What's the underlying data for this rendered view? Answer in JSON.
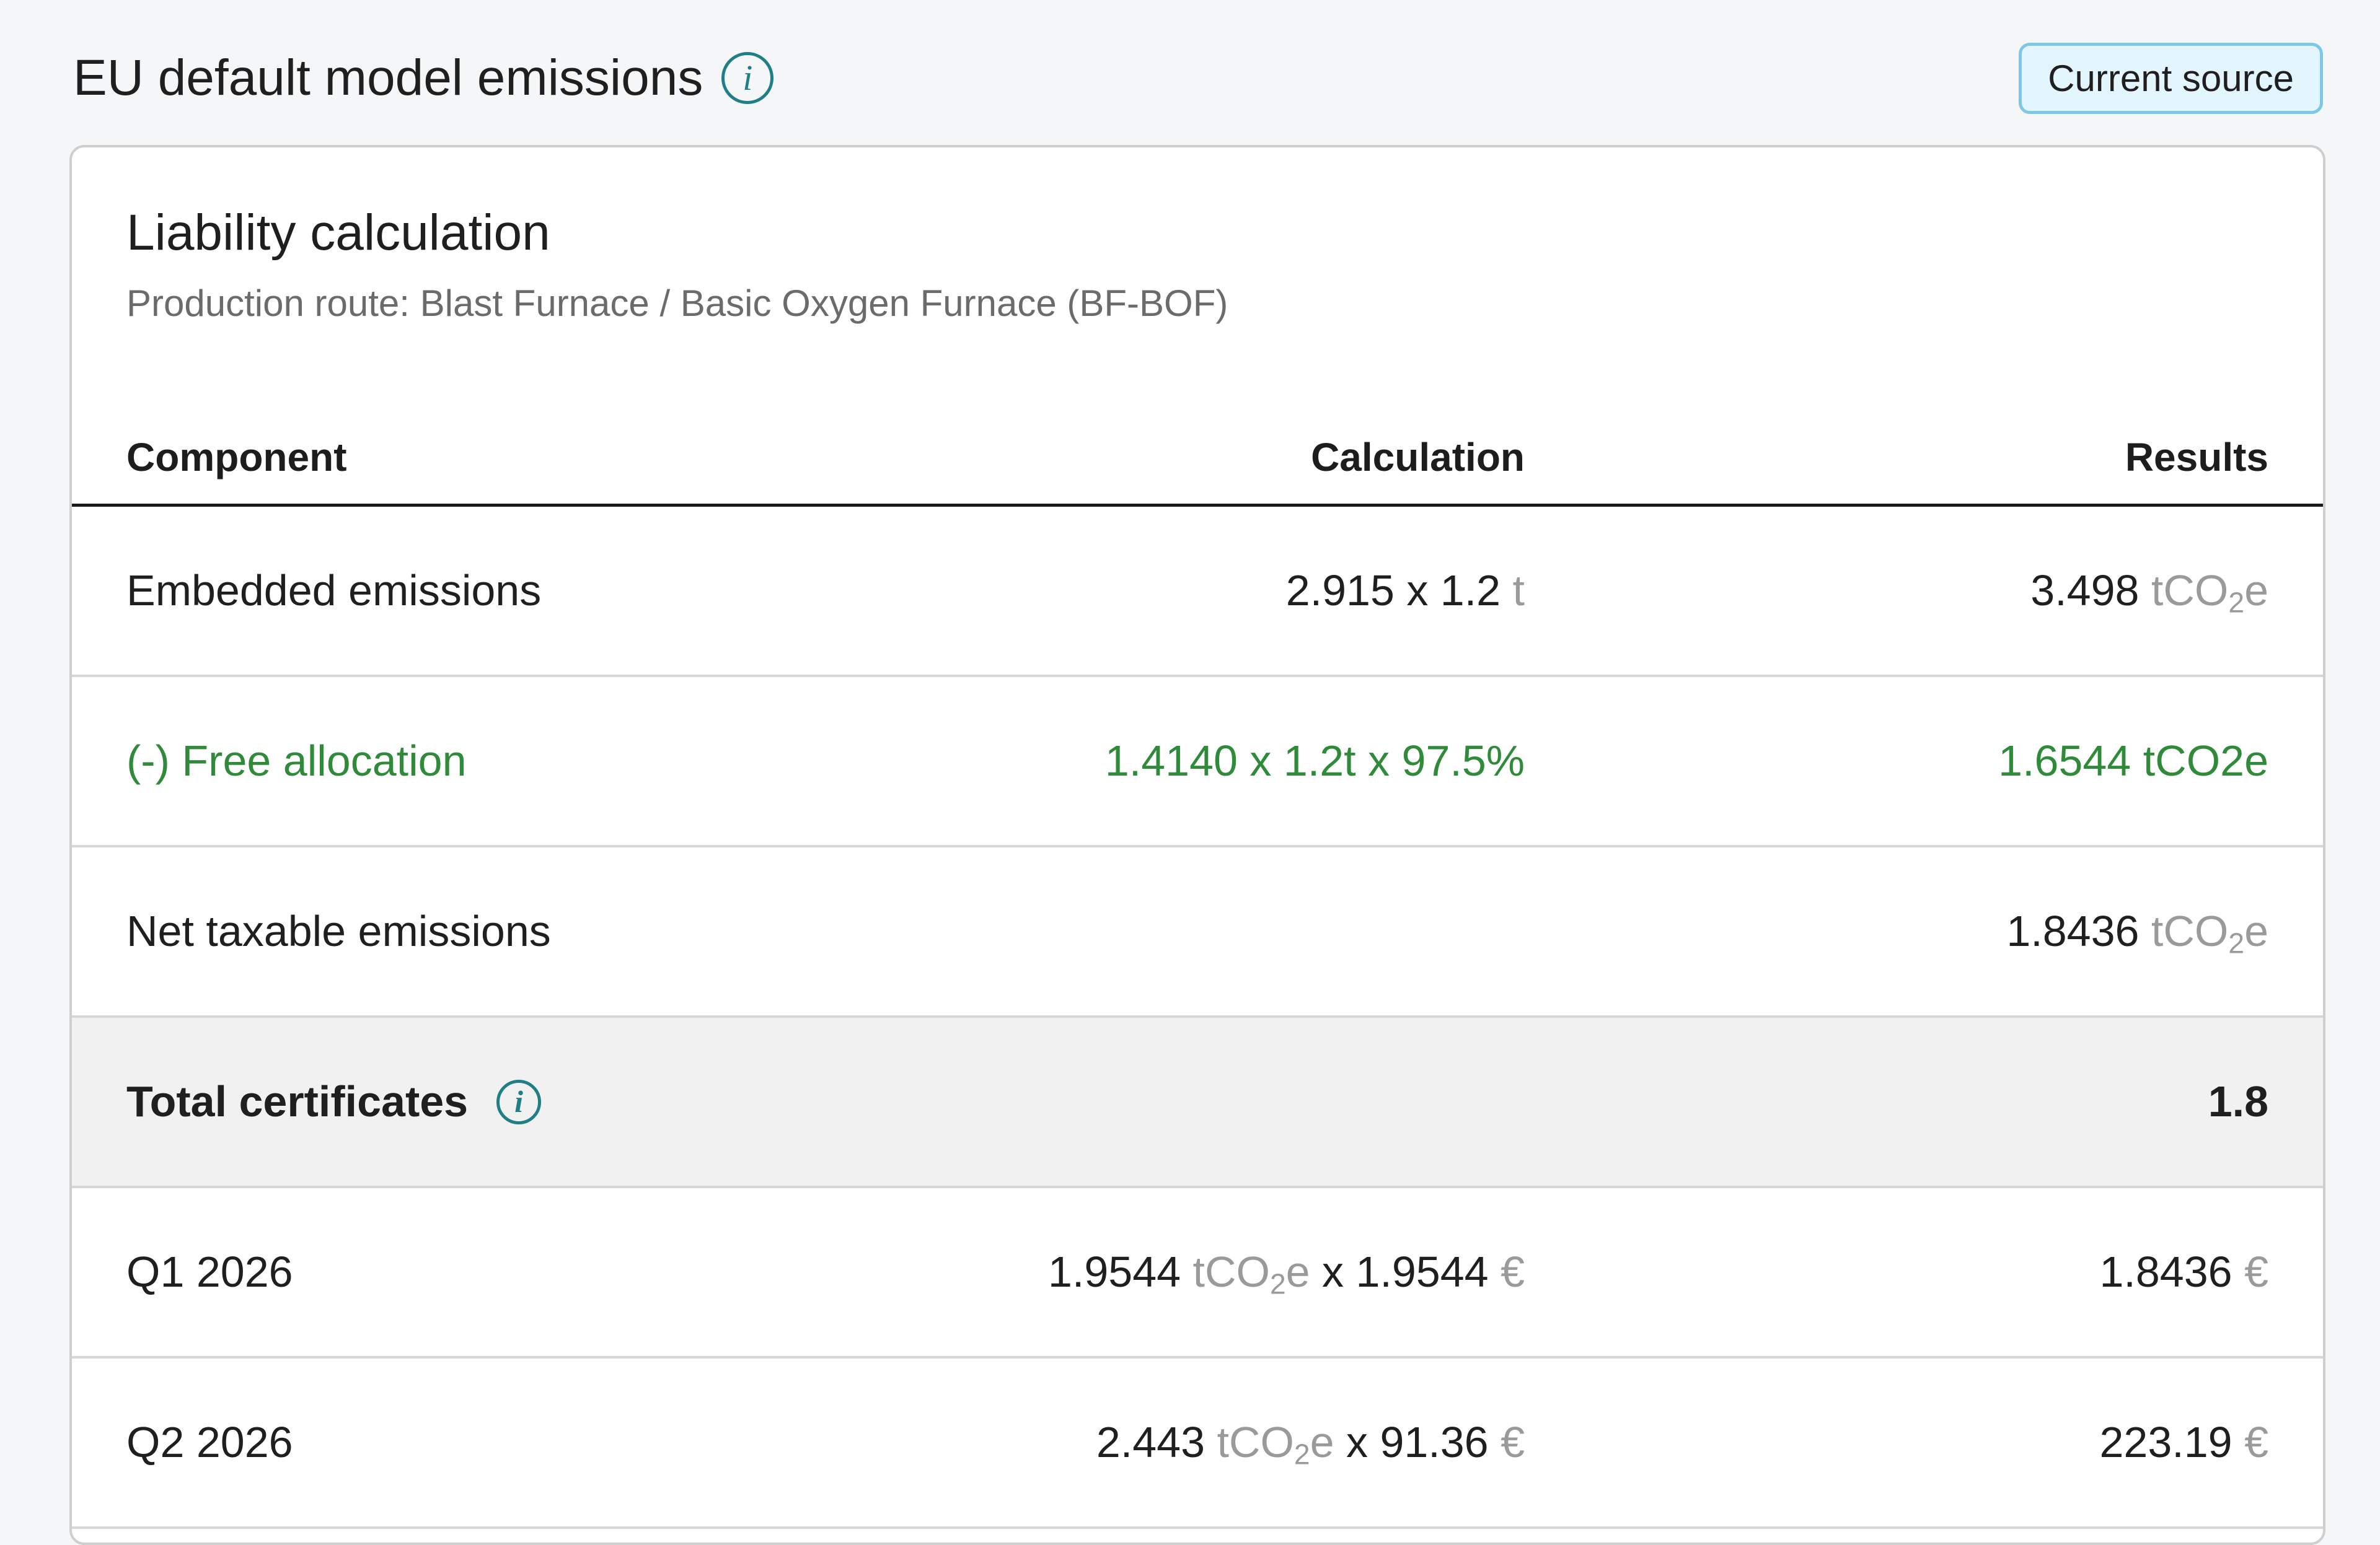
{
  "header": {
    "title": "EU default model emissions",
    "info_icon": "info-icon",
    "current_source_label": "Current source"
  },
  "card": {
    "title": "Liability calculation",
    "subtitle": "Production route: Blast Furnace / Basic Oxygen Furnace (BF-BOF)",
    "columns": {
      "component": "Component",
      "calculation": "Calculation",
      "results": "Results"
    },
    "rows": [
      {
        "component": "Embedded emissions",
        "calculation_value": "2.915 x 1.2",
        "calculation_unit": "t",
        "result_value": "3.498",
        "result_unit_prefix": "tCO",
        "result_unit_sub": "2",
        "result_unit_suffix": "e"
      },
      {
        "component": "(-) Free allocation",
        "calculation": "1.4140 x 1.2t x 97.5%",
        "result": "1.6544 tCO2e",
        "accent_color": "#2f8a3a"
      },
      {
        "component": "Net taxable emissions",
        "result_value": "1.8436",
        "result_unit_prefix": "tCO",
        "result_unit_sub": "2",
        "result_unit_suffix": "e"
      },
      {
        "component": "Total certificates",
        "result": "1.8"
      },
      {
        "component": "Q1 2026",
        "calc_value_1": "1.9544",
        "calc_unit_prefix": "tCO",
        "calc_unit_sub": "2",
        "calc_unit_suffix": "e",
        "calc_operator": "x",
        "calc_value_2": "1.9544",
        "calc_currency": "€",
        "result_value": "1.8436",
        "result_currency": "€"
      },
      {
        "component": "Q2 2026",
        "calc_value_1": "2.443",
        "calc_unit_prefix": "tCO",
        "calc_unit_sub": "2",
        "calc_unit_suffix": "e",
        "calc_operator": "x",
        "calc_value_2": "91.36",
        "calc_currency": "€",
        "result_value": "223.19",
        "result_currency": "€"
      }
    ]
  },
  "colors": {
    "background": "#f4f6f8",
    "accent_teal": "#1f7f86",
    "badge_background": "#e3f6fd",
    "badge_border": "#7fc7e6",
    "positive_green": "#2f8a3a",
    "muted_unit": "#9a9a9a",
    "total_row_background": "#f1f1f1"
  }
}
